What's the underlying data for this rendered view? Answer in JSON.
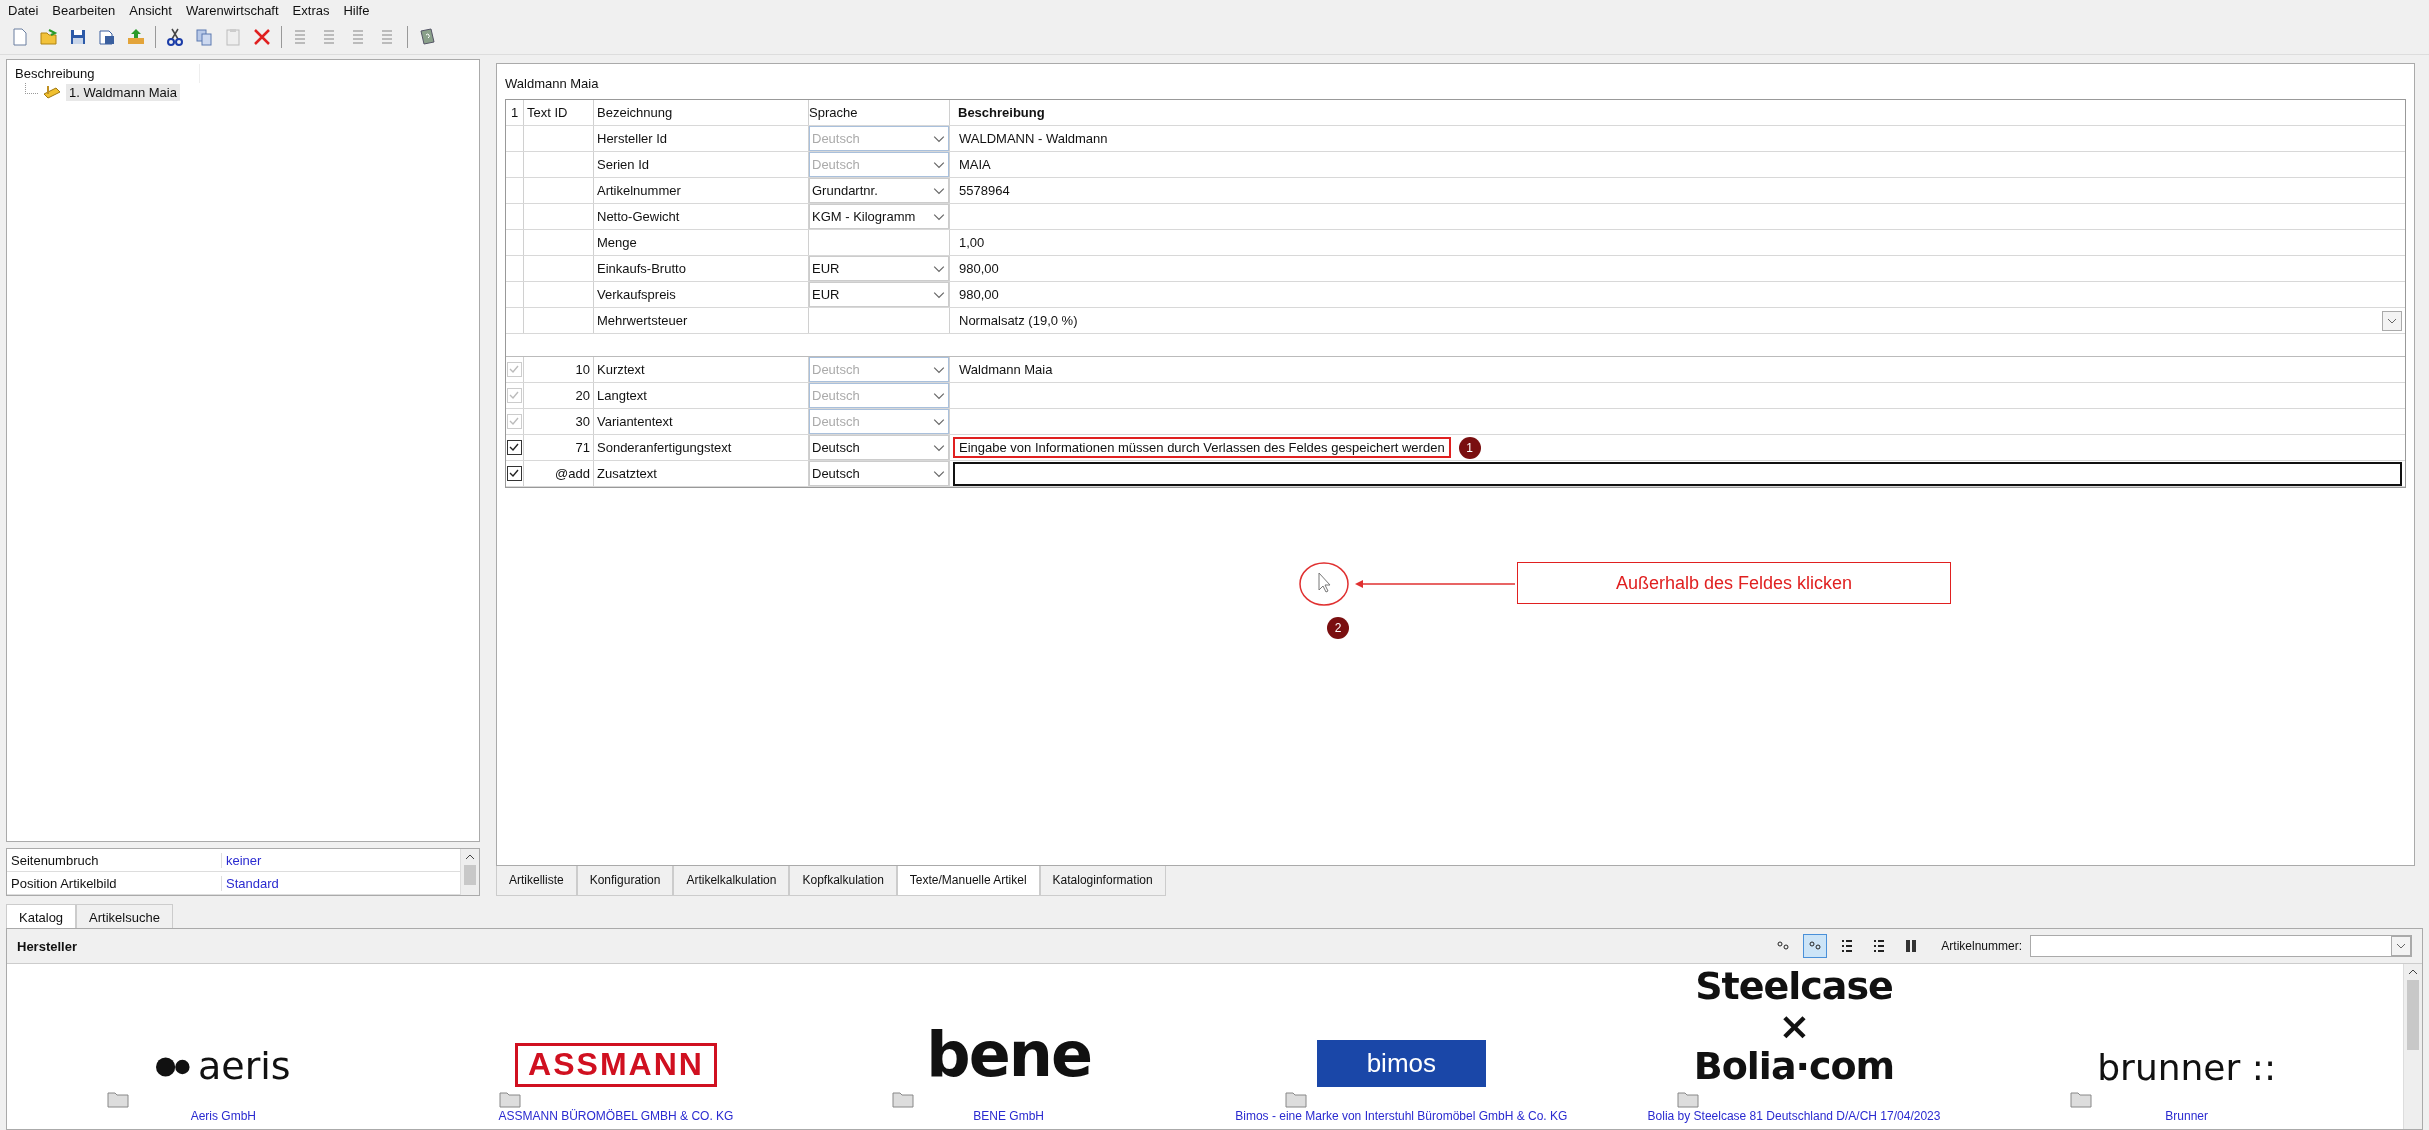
{
  "menu": [
    "Datei",
    "Bearbeiten",
    "Ansicht",
    "Warenwirtschaft",
    "Extras",
    "Hilfe"
  ],
  "tree": {
    "header": "Beschreibung",
    "items": [
      {
        "label": "1. Waldmann Maia",
        "selected": true
      }
    ]
  },
  "properties": [
    {
      "label": "Seitenumbruch",
      "value": "keiner"
    },
    {
      "label": "Position Artikelbild",
      "value": "Standard"
    }
  ],
  "editor": {
    "title": "Waldmann Maia",
    "columns": [
      {
        "label": "1",
        "bold": false
      },
      {
        "label": "Text ID",
        "bold": false
      },
      {
        "label": "Bezeichnung",
        "bold": false
      },
      {
        "label": "Sprache",
        "bold": false
      },
      {
        "label": "Beschreibung",
        "bold": true
      }
    ],
    "rows": [
      {
        "kind": "property",
        "label": "Hersteller Id",
        "language": {
          "value": "Deutsch",
          "disabled": true
        },
        "description": "WALDMANN - Waldmann"
      },
      {
        "kind": "property",
        "label": "Serien Id",
        "language": {
          "value": "Deutsch",
          "disabled": true
        },
        "description": "MAIA"
      },
      {
        "kind": "property",
        "label": "Artikelnummer",
        "language": {
          "value": "Grundartnr.",
          "disabled": false
        },
        "description": "5578964"
      },
      {
        "kind": "property",
        "label": "Netto-Gewicht",
        "language": {
          "value": "KGM - Kilogramm",
          "disabled": false
        }
      },
      {
        "kind": "property",
        "label": "Menge",
        "description": "1,00"
      },
      {
        "kind": "property",
        "label": "Einkaufs-Brutto",
        "language": {
          "value": "EUR",
          "disabled": false
        },
        "description": "980,00"
      },
      {
        "kind": "property",
        "label": "Verkaufspreis",
        "language": {
          "value": "EUR",
          "disabled": false
        },
        "description": "980,00"
      },
      {
        "kind": "property",
        "label": "Mehrwertsteuer",
        "description": "Normalsatz (19,0 %)",
        "description_dropdown": true
      },
      {
        "kind": "spacer"
      },
      {
        "kind": "text",
        "checked": true,
        "disabled": true,
        "text_id": "10",
        "label": "Kurztext",
        "language": {
          "value": "Deutsch",
          "disabled": true
        },
        "description": "Waldmann Maia"
      },
      {
        "kind": "text",
        "checked": true,
        "disabled": true,
        "text_id": "20",
        "label": "Langtext",
        "language": {
          "value": "Deutsch",
          "disabled": true
        }
      },
      {
        "kind": "text",
        "checked": true,
        "disabled": true,
        "text_id": "30",
        "label": "Variantentext",
        "language": {
          "value": "Deutsch",
          "disabled": true
        }
      },
      {
        "kind": "text",
        "checked": true,
        "disabled": false,
        "text_id": "71",
        "label": "Sonderanfertigungstext",
        "language": {
          "value": "Deutsch",
          "disabled": false
        },
        "description": "Eingabe von Informationen müssen durch Verlassen des Feldes gespeichert werden",
        "highlighted": true,
        "marker": "1"
      },
      {
        "kind": "text",
        "checked": true,
        "disabled": false,
        "text_id": "@add",
        "label": "Zusatztext",
        "language": {
          "value": "Deutsch",
          "disabled": false
        },
        "editing": true
      }
    ],
    "annotation": {
      "marker": "2",
      "text": "Außerhalb des Feldes klicken"
    }
  },
  "tabs": [
    {
      "label": "Artikelliste",
      "selected": false
    },
    {
      "label": "Konfiguration",
      "selected": false
    },
    {
      "label": "Artikelkalkulation",
      "selected": false
    },
    {
      "label": "Kopfkalkulation",
      "selected": false
    },
    {
      "label": "Texte/Manuelle Artikel",
      "selected": true
    },
    {
      "label": "Kataloginformation",
      "selected": false
    }
  ],
  "catalog_tabs": [
    {
      "label": "Katalog",
      "selected": true
    },
    {
      "label": "Artikelsuche",
      "selected": false
    }
  ],
  "catalog": {
    "title": "Hersteller",
    "view_modes": [
      {
        "selected": false
      },
      {
        "selected": true
      },
      {
        "selected": false
      },
      {
        "selected": false
      },
      {
        "selected": false
      }
    ],
    "search_label": "Artikelnummer:",
    "manufacturers": [
      {
        "kind": "aeris",
        "logo": [
          "aeris"
        ],
        "name": "Aeris GmbH"
      },
      {
        "kind": "assmann",
        "logo": [
          "ASSMANN"
        ],
        "name": "ASSMANN BÜROMÖBEL GMBH & CO. KG"
      },
      {
        "kind": "bene",
        "logo": [
          "bene"
        ],
        "name": "BENE GmbH"
      },
      {
        "kind": "bimos",
        "logo": [
          "bimos"
        ],
        "name": "Bimos - eine Marke von Interstuhl Büromöbel GmbH & Co. KG"
      },
      {
        "kind": "steelcase",
        "logo": [
          "Steelcase",
          "×",
          "Bolia·com"
        ],
        "name": "Bolia by Steelcase 81 Deutschland D/A/CH 17/04/2023"
      },
      {
        "kind": "brunner",
        "logo": [
          "brunner ::"
        ],
        "name": "Brunner"
      }
    ]
  }
}
